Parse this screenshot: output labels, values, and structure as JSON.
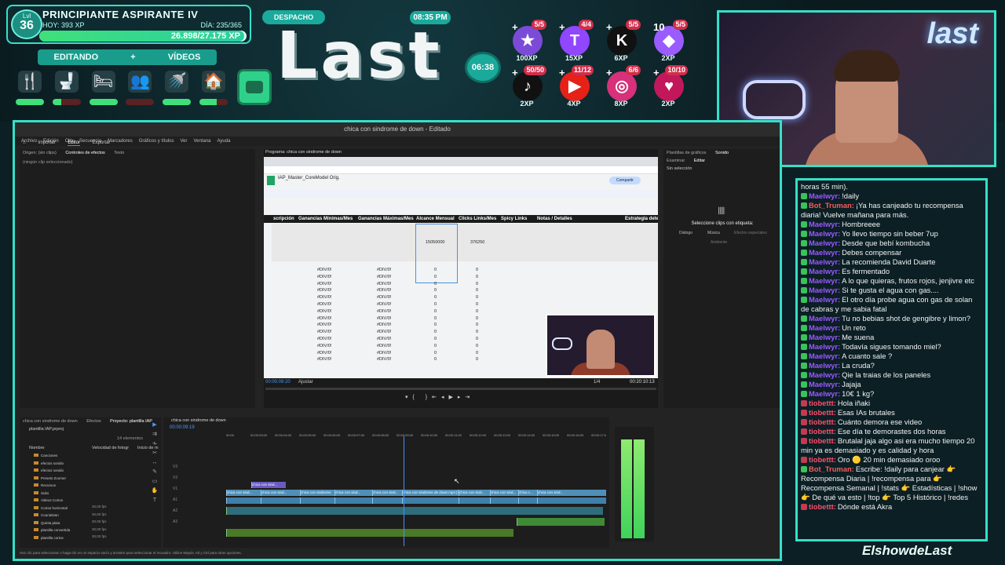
{
  "overlay": {
    "level_label": "Lvl",
    "level": "36",
    "rank": "PRINCIPIANTE ASPIRANTE IV",
    "today": "HOY: 393 XP",
    "day": "DÍA: 235/365",
    "xp_progress": "26.898/27.175 XP",
    "xp_fraction": 0.99,
    "mode_left": "EDITANDO",
    "mode_plus": "+",
    "mode_right": "VÍDEOS",
    "needs": [
      {
        "icon": "fork-knife-icon",
        "glyph": "🍴",
        "level": 1.0,
        "color": "#3fe07a"
      },
      {
        "icon": "toilet-icon",
        "glyph": "🚽",
        "level": 0.3,
        "color": "#3fe07a"
      },
      {
        "icon": "bed-icon",
        "glyph": "🛏",
        "level": 1.0,
        "color": "#3fe07a"
      },
      {
        "icon": "social-icon",
        "glyph": "👥",
        "level": 0.0,
        "color": "#3fe07a"
      },
      {
        "icon": "shower-icon",
        "glyph": "🚿",
        "level": 1.0,
        "color": "#3fe07a"
      },
      {
        "icon": "home-icon",
        "glyph": "🏠",
        "level": 0.6,
        "color": "#3fe07a"
      }
    ],
    "despacho": "DESPACHO",
    "clock": "08:35 PM",
    "logo": "Last",
    "timer": "06:38",
    "socials": [
      {
        "name": "star-icon",
        "glyph": "★",
        "bg": "#7b4bd8",
        "count": "5/5",
        "xp": "100XP"
      },
      {
        "name": "twitch-icon",
        "glyph": "T",
        "bg": "#9146ff",
        "count": "4/4",
        "xp": "15XP"
      },
      {
        "name": "kick-icon",
        "glyph": "K",
        "bg": "#111111",
        "count": "5/5",
        "xp": "6XP"
      },
      {
        "name": "gem-icon",
        "glyph": "◆",
        "bg": "#9a5cff",
        "count": "5/5",
        "xp": "2XP",
        "prefix": "10"
      },
      {
        "name": "tiktok-icon",
        "glyph": "♪",
        "bg": "#111111",
        "count": "50/50",
        "xp": "2XP"
      },
      {
        "name": "youtube-icon",
        "glyph": "▶",
        "bg": "#e62117",
        "count": "11/12",
        "xp": "4XP"
      },
      {
        "name": "instagram-icon",
        "glyph": "◎",
        "bg": "#d6317a",
        "count": "6/6",
        "xp": "8XP"
      },
      {
        "name": "heart-rate-icon",
        "glyph": "♥",
        "bg": "#c2185b",
        "count": "10/10",
        "xp": "2XP"
      }
    ]
  },
  "webcam": {
    "logo": "last"
  },
  "editor": {
    "window_title": "chica con sindrome de down - Editado",
    "menu": [
      "Archivo",
      "Edición",
      "Clip",
      "Secuencia",
      "Marcadores",
      "Gráficos y títulos",
      "Ver",
      "Ventana",
      "Ayuda"
    ],
    "workspaces": [
      "Importar",
      "Editor",
      "Exportar"
    ],
    "source_tabs": [
      "Origen: (sin clips)",
      "Controles de efectos",
      "Texto"
    ],
    "source_empty": "(ningún clip seleccionado)",
    "program_title": "Programa: chica con sindrome de down",
    "sheet_title": "IAP_Master_CoreModel Orig.",
    "sheet_headers": [
      "scripción",
      "Ganancias Mínimas/Mes",
      "Ganancias Máximas/Mes",
      "Alcance Mensual",
      "Clicks Links/Mes",
      "Spicy Links",
      "Notas / Detalles",
      "Estrategia dete"
    ],
    "sheet_value_1": "15050000",
    "sheet_value_2": "376250",
    "div_error": "#DIV/0!",
    "zero": "0",
    "timecode_left": "00:00:09:20",
    "fit_label": "Ajustar",
    "zoom_label": "1/4",
    "timecode_right": "00:20:10:13",
    "right_tabs": [
      "Plantillas de gráficos",
      "Sonido"
    ],
    "right_sub": [
      "Examinar",
      "Editar"
    ],
    "right_selection": "Sin selección",
    "right_label": "Seleccione clips con etiqueta:",
    "right_options": [
      "Diálogo",
      "Música",
      "Efectos especiales",
      "Ambiente"
    ],
    "project_tabs": [
      "chica con sindrome de down",
      "Efectos",
      "Proyecto: plantilla IAP"
    ],
    "project_file": "plantilla IAP.prproj",
    "project_count": "14 elementos",
    "project_cols": [
      "Nombre",
      "Velocidad de fotogr",
      "Inicio de m"
    ],
    "project_items": [
      "Canciones",
      "efectos sonido",
      "efectos sonido",
      "Presets Zoomer",
      "Recursos",
      "Subs",
      "Videos Cortos",
      "Cortos horizontal",
      "Countdown",
      "Quinta plata",
      "plantilla convertida",
      "plantilla cortos"
    ],
    "project_fps": [
      "30,00 fps",
      "30,00 fps",
      "30,00 fps",
      "30,00 fps",
      "30,00 fps"
    ],
    "timeline_title": "chica con sindrome de down",
    "timeline_timecode": "00:00:09:19",
    "ruler": [
      "00:00",
      "00:00:03:00",
      "00:00:04:00",
      "00:00:05:00",
      "00:00:06:00",
      "00:00:07:00",
      "00:00:08:00",
      "00:00:09:00",
      "00:00:10:00",
      "00:00:11:00",
      "00:00:12:00",
      "00:00:13:00",
      "00:00:14:00",
      "00:00:15:00",
      "00:00:16:00",
      "00:00:17:0"
    ],
    "clip_labels": [
      "chica con sind...",
      "chica con sind...",
      "chica con sindrome",
      "chica con sind...",
      "chica con sind...",
      "chica con sindrome de down.mp4 [V]",
      "chica con sind...",
      "chica con sind...",
      "chica c...",
      "chica con sind..."
    ],
    "status": "Haz clic para seleccionar o haga clic en un espacio vacío y arrastre para seleccionar el recuadro. Utilice Mayús, Alt y Ctrl para otras opciones."
  },
  "chat": [
    {
      "user": "",
      "msg": "horas 55 min).",
      "color": "#ffffff",
      "badge": false
    },
    {
      "user": "Maelwyr:",
      "msg": "!daily",
      "color": "#9b59ff",
      "badge": true
    },
    {
      "user": "Bot_Truman:",
      "msg": "¡Ya has canjeado tu recompensa diaria! Vuelve mañana para más.",
      "color": "#ff5a5a",
      "badge": true
    },
    {
      "user": "Maelwyr:",
      "msg": "Hombreeee",
      "color": "#9b59ff",
      "badge": true
    },
    {
      "user": "Maelwyr:",
      "msg": "Yo llevo tiempo sin beber 7up",
      "color": "#9b59ff",
      "badge": true
    },
    {
      "user": "Maelwyr:",
      "msg": "Desde que bebí kombucha",
      "color": "#9b59ff",
      "badge": true
    },
    {
      "user": "Maelwyr:",
      "msg": "Debes compensar",
      "color": "#9b59ff",
      "badge": true
    },
    {
      "user": "Maelwyr:",
      "msg": "La recomienda David Duarte",
      "color": "#9b59ff",
      "badge": true
    },
    {
      "user": "Maelwyr:",
      "msg": "Es fermentado",
      "color": "#9b59ff",
      "badge": true
    },
    {
      "user": "Maelwyr:",
      "msg": "A lo que quieras, frutos rojos, jenjivre etc",
      "color": "#9b59ff",
      "badge": true
    },
    {
      "user": "Maelwyr:",
      "msg": "Si te gusta el agua con gas....",
      "color": "#9b59ff",
      "badge": true
    },
    {
      "user": "Maelwyr:",
      "msg": "El otro día probe agua con gas de solan de cabras y me sabia fatal",
      "color": "#9b59ff",
      "badge": true
    },
    {
      "user": "Maelwyr:",
      "msg": "Tu no bebias shot de gengibre y limon?",
      "color": "#9b59ff",
      "badge": true
    },
    {
      "user": "Maelwyr:",
      "msg": "Un reto",
      "color": "#9b59ff",
      "badge": true
    },
    {
      "user": "Maelwyr:",
      "msg": "Me suena",
      "color": "#9b59ff",
      "badge": true
    },
    {
      "user": "Maelwyr:",
      "msg": "Todavía sigues tomando miel?",
      "color": "#9b59ff",
      "badge": true
    },
    {
      "user": "Maelwyr:",
      "msg": "A cuanto sale ?",
      "color": "#9b59ff",
      "badge": true
    },
    {
      "user": "Maelwyr:",
      "msg": "La cruda?",
      "color": "#9b59ff",
      "badge": true
    },
    {
      "user": "Maelwyr:",
      "msg": "Qie la traias de los paneles",
      "color": "#9b59ff",
      "badge": true
    },
    {
      "user": "Maelwyr:",
      "msg": "Jajaja",
      "color": "#9b59ff",
      "badge": true
    },
    {
      "user": "Maelwyr:",
      "msg": "10€ 1 kg?",
      "color": "#9b59ff",
      "badge": true
    },
    {
      "user": "tiobettt:",
      "msg": "Hola iñaki",
      "color": "#ff4d6d",
      "badge": false
    },
    {
      "user": "tiobettt:",
      "msg": "Esas IAs brutales",
      "color": "#ff4d6d",
      "badge": false
    },
    {
      "user": "tiobettt:",
      "msg": "Cuánto demora ese video",
      "color": "#ff4d6d",
      "badge": false
    },
    {
      "user": "tiobettt:",
      "msg": "Ese día te demorastes dos horas",
      "color": "#ff4d6d",
      "badge": false
    },
    {
      "user": "tiobettt:",
      "msg": "Brutalal jaja algo asi era mucho tiempo 20 min ya es demasiado y es calidad y hora",
      "color": "#ff4d6d",
      "badge": false
    },
    {
      "user": "tiobettt:",
      "msg": "Oro 🟡 20 min demasiado oroo",
      "color": "#ff4d6d",
      "badge": false
    },
    {
      "user": "Bot_Truman:",
      "msg": "Escribe: !daily para canjear 👉 Recompensa Diaria | !recompensa para 👉 Recompensa Semanal | !stats 👉 Estadísticas | !show 👉 De qué va esto | !top 👉 Top 5 Histórico | !redes",
      "color": "#ff5a5a",
      "badge": true
    },
    {
      "user": "tiobettt:",
      "msg": "Dónde está Akra",
      "color": "#ff4d6d",
      "badge": false
    }
  ],
  "footer": "ElshowdeLast"
}
